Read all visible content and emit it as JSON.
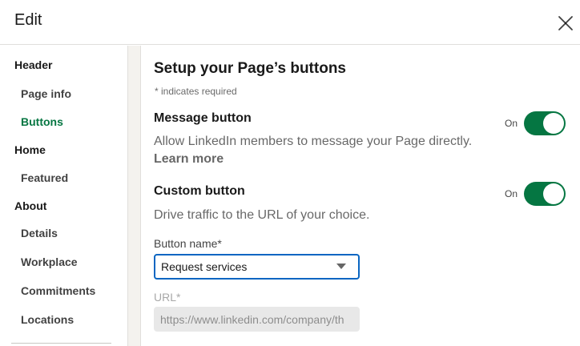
{
  "header": {
    "title": "Edit"
  },
  "sidebar": {
    "items": [
      {
        "label": "Header",
        "kind": "section"
      },
      {
        "label": "Page info",
        "kind": "sub"
      },
      {
        "label": "Buttons",
        "kind": "sub",
        "active": true
      },
      {
        "label": "Home",
        "kind": "section"
      },
      {
        "label": "Featured",
        "kind": "sub"
      },
      {
        "label": "About",
        "kind": "section"
      },
      {
        "label": "Details",
        "kind": "sub"
      },
      {
        "label": "Workplace",
        "kind": "sub"
      },
      {
        "label": "Commitments",
        "kind": "sub"
      },
      {
        "label": "Locations",
        "kind": "sub"
      }
    ]
  },
  "main": {
    "title": "Setup your Page’s buttons",
    "required_note": "*  indicates required",
    "message_button": {
      "title": "Message button",
      "state_label": "On",
      "enabled": true,
      "description": "Allow LinkedIn members to message your Page directly.",
      "learn_more": "Learn more"
    },
    "custom_button": {
      "title": "Custom button",
      "state_label": "On",
      "enabled": true,
      "description": "Drive traffic to the URL of your choice."
    },
    "button_name": {
      "label": "Button name*",
      "selected": "Request services"
    },
    "url": {
      "label": "URL*",
      "placeholder": "https://www.linkedin.com/company/th"
    }
  },
  "colors": {
    "accent_green": "#057642",
    "focus_blue": "#0a66c2"
  }
}
